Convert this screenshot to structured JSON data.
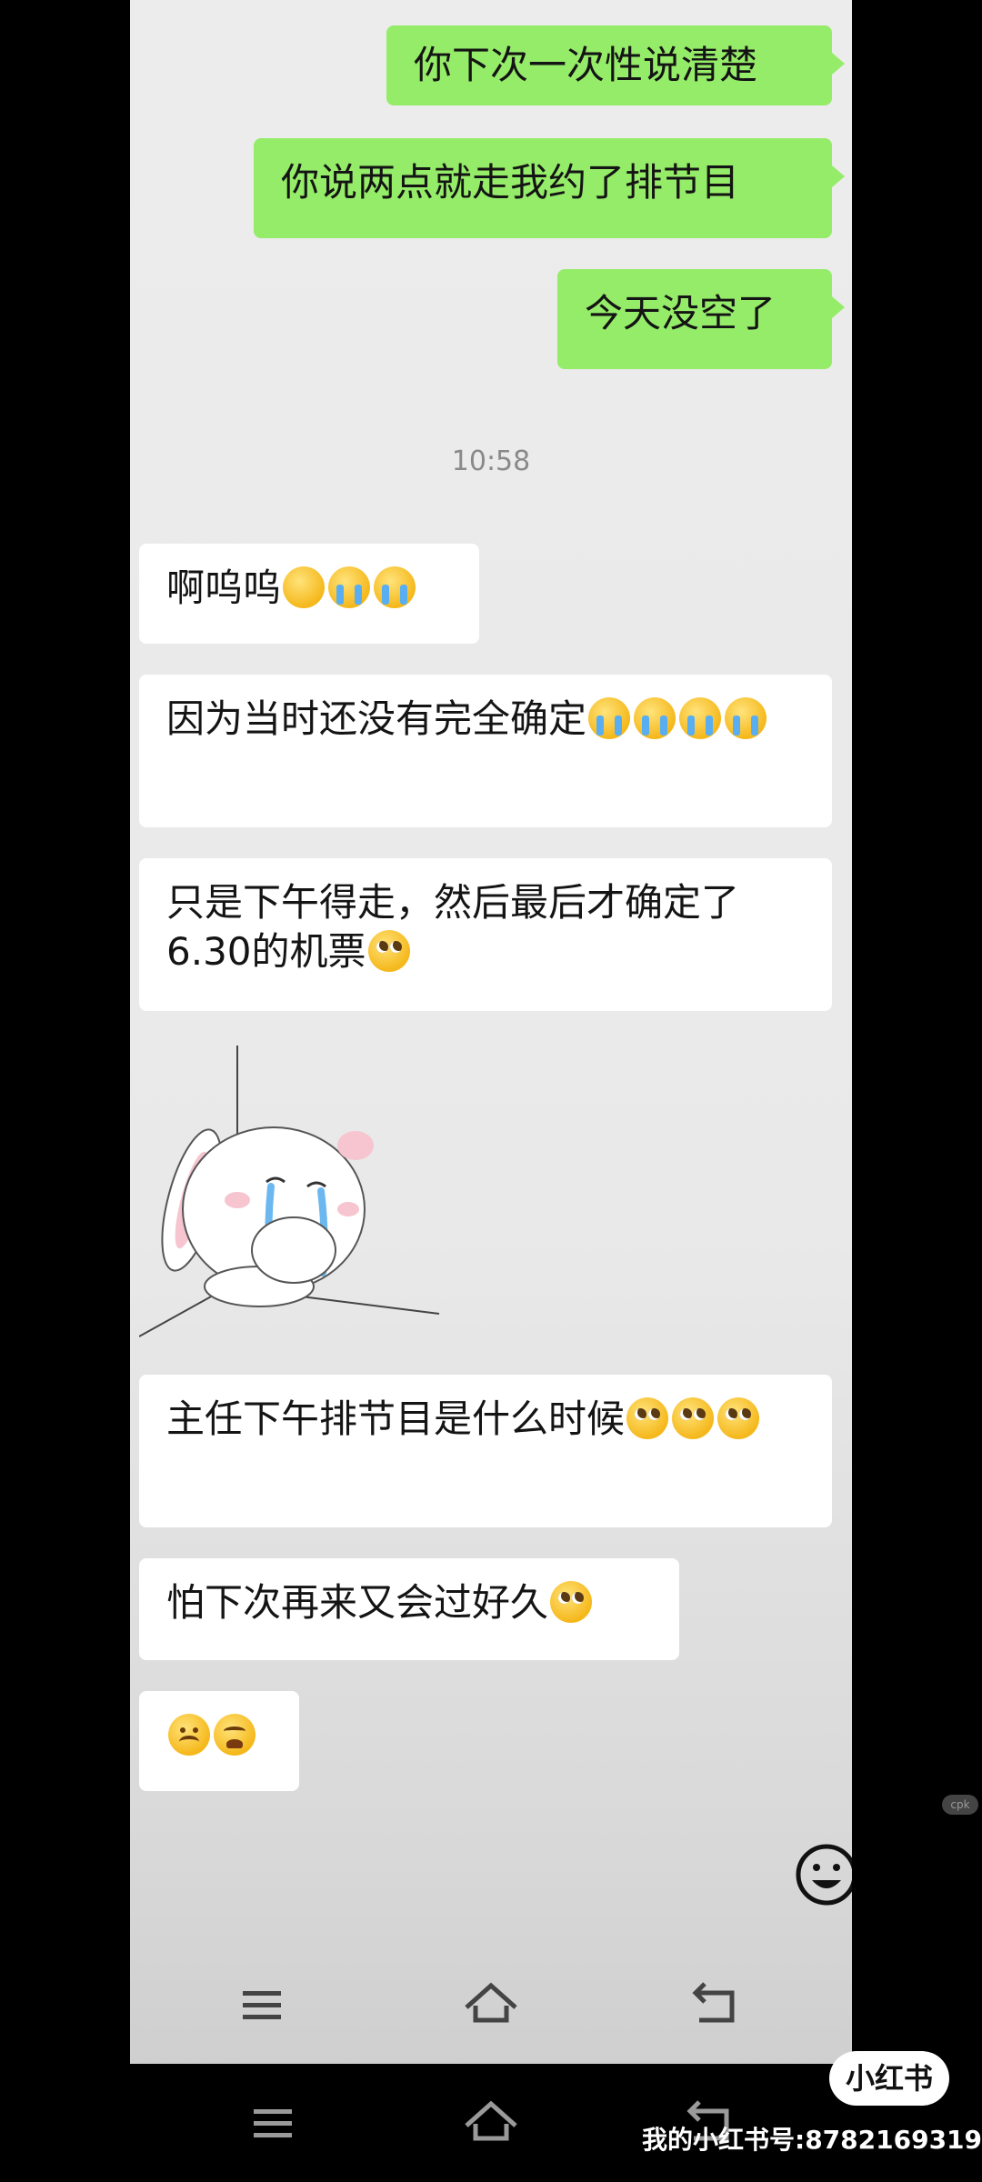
{
  "chat": {
    "outgoing": [
      {
        "text": "你下次一次性说清楚"
      },
      {
        "text": "你说两点就走我约了排节目"
      },
      {
        "text": "今天没空了"
      }
    ],
    "timestamp": "10:58",
    "incoming": [
      {
        "text": "啊呜呜",
        "emojis": [
          "tear-smile-icon",
          "sob-icon",
          "sob-icon"
        ]
      },
      {
        "text": "因为当时还没有完全确定",
        "emojis": [
          "sob-icon",
          "sob-icon",
          "sob-icon",
          "sob-icon"
        ]
      },
      {
        "text": "只是下午得走，然后最后才确定了6.30的机票",
        "emojis": [
          "pleading-icon"
        ]
      },
      {
        "text": "主任下午排节目是什么时候",
        "emojis": [
          "pleading-icon",
          "pleading-icon",
          "pleading-icon"
        ]
      },
      {
        "text": "怕下次再来又会过好久",
        "emojis": [
          "pleading-icon"
        ]
      },
      {
        "text": "",
        "emojis": [
          "frowning-icon",
          "weary-icon"
        ]
      }
    ],
    "sticker": "crying-bunny-sticker"
  },
  "input": {
    "placeholder": "",
    "emoji_button_icon": "smile-icon"
  },
  "nav": {
    "icons": [
      "menu-icon",
      "home-icon",
      "back-icon"
    ]
  },
  "watermark": {
    "logo": "小红书",
    "id_text": "我的小红书号:8782169319",
    "badge": "cpk"
  },
  "colors": {
    "outgoing_bubble": "#95ec69",
    "incoming_bubble": "#ffffff",
    "chat_background": "#ececec"
  }
}
